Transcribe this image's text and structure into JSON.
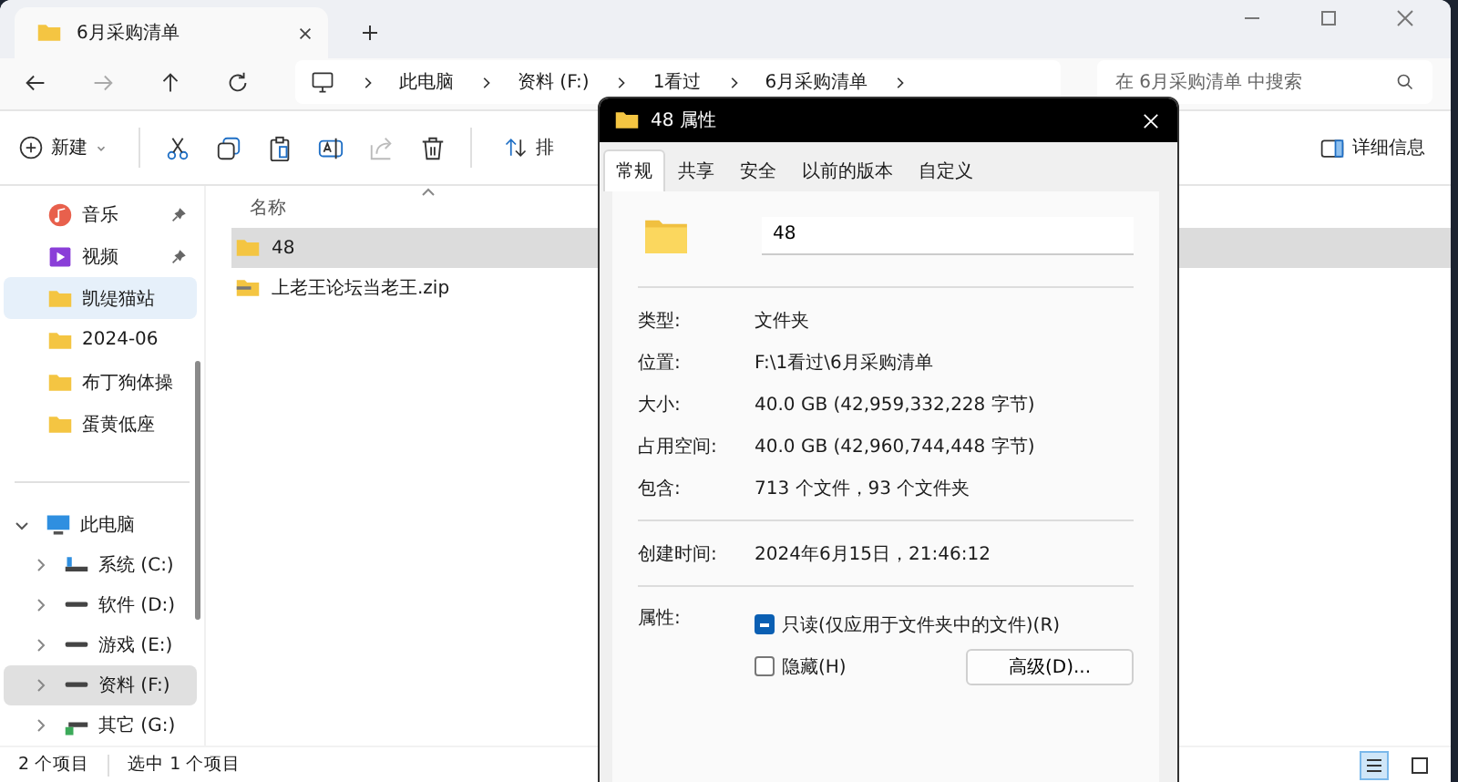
{
  "window": {
    "tab_title": "6月采购清单"
  },
  "address": {
    "breadcrumbs": [
      "此电脑",
      "资料 (F:)",
      "1看过",
      "6月采购清单"
    ],
    "search_placeholder": "在 6月采购清单 中搜索"
  },
  "toolbar": {
    "new_label": "新建",
    "sort_label": "排",
    "details_label": "详细信息"
  },
  "sidebar": {
    "quick_access": [
      {
        "label": "音乐",
        "kind": "music",
        "pinned": true,
        "selected": false
      },
      {
        "label": "视频",
        "kind": "video",
        "pinned": true,
        "selected": false
      },
      {
        "label": "凯缇猫站",
        "kind": "folder",
        "pinned": false,
        "selected": true
      },
      {
        "label": "2024-06",
        "kind": "folder",
        "pinned": false,
        "selected": false
      },
      {
        "label": "布丁狗体操",
        "kind": "folder",
        "pinned": false,
        "selected": false
      },
      {
        "label": "蛋黄低座",
        "kind": "folder",
        "pinned": false,
        "selected": false
      }
    ],
    "tree": [
      {
        "label": "此电脑",
        "kind": "pc",
        "expanded": true,
        "selected": false,
        "children": [
          {
            "label": "系统 (C:)",
            "kind": "system",
            "expanded": false,
            "selected": false
          },
          {
            "label": "软件 (D:)",
            "kind": "drive",
            "expanded": false,
            "selected": false
          },
          {
            "label": "游戏 (E:)",
            "kind": "drive",
            "expanded": false,
            "selected": false
          },
          {
            "label": "资料 (F:)",
            "kind": "drive",
            "expanded": false,
            "selected": true
          },
          {
            "label": "其它 (G:)",
            "kind": "network",
            "expanded": false,
            "selected": false
          }
        ]
      }
    ]
  },
  "files": {
    "column": "名称",
    "items": [
      {
        "name": "48",
        "kind": "folder",
        "selected": true
      },
      {
        "name": "上老王论坛当老王.zip",
        "kind": "zip",
        "selected": false
      }
    ]
  },
  "status_bar": {
    "count": "2 个项目",
    "selection": "选中 1 个项目"
  },
  "dialog": {
    "title": "48 属性",
    "tabs": [
      {
        "label": "常规",
        "selected": true
      },
      {
        "label": "共享",
        "selected": false
      },
      {
        "label": "安全",
        "selected": false
      },
      {
        "label": "以前的版本",
        "selected": false
      },
      {
        "label": "自定义",
        "selected": false
      }
    ],
    "name_value": "48",
    "sections": [
      [
        {
          "label": "类型:",
          "value": "文件夹"
        },
        {
          "label": "位置:",
          "value": "F:\\1看过\\6月采购清单"
        },
        {
          "label": "大小:",
          "value": "40.0 GB (42,959,332,228 字节)"
        },
        {
          "label": "占用空间:",
          "value": "40.0 GB (42,960,744,448 字节)"
        },
        {
          "label": "包含:",
          "value": "713 个文件，93 个文件夹"
        }
      ],
      [
        {
          "label": "创建时间:",
          "value": "2024年6月15日，21:46:12"
        }
      ]
    ],
    "attributes_label": "属性:",
    "attributes": [
      {
        "label": "只读(仅应用于文件夹中的文件)(R)",
        "indeterminate": true
      },
      {
        "label": "隐藏(H)",
        "indeterminate": false
      }
    ],
    "advanced_button": "高级(D)..."
  }
}
